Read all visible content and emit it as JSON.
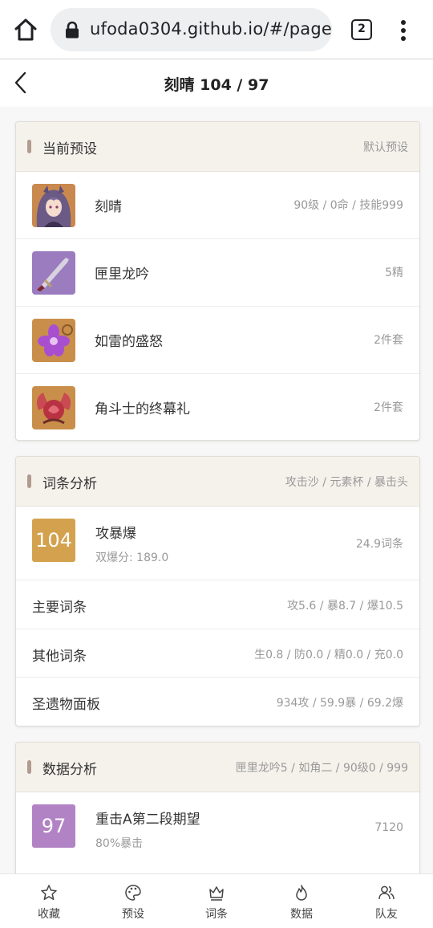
{
  "browser": {
    "url": "ufoda0304.github.io/#/pages",
    "tab_count": "2"
  },
  "header": {
    "title": "刻晴 104 / 97"
  },
  "preset": {
    "title": "当前预设",
    "right": "默认预设",
    "items": [
      {
        "icon": "keqing-character-portrait",
        "name": "刻晴",
        "value": "90级 / 0命 / 技能999"
      },
      {
        "icon": "mistsplitter-sword-icon",
        "name": "匣里龙吟",
        "value": "5精"
      },
      {
        "icon": "thundering-fury-flower-icon",
        "name": "如雷的盛怒",
        "value": "2件套"
      },
      {
        "icon": "gladiator-flower-icon",
        "name": "角斗士的终幕礼",
        "value": "2件套"
      }
    ]
  },
  "substats": {
    "title": "词条分析",
    "right": "攻击沙 / 元素杯 / 暴击头",
    "score": "104",
    "score_color": "#d4a24e",
    "score_title": "攻暴爆",
    "score_sub": "双爆分: 189.0",
    "score_value": "24.9词条",
    "rows": [
      {
        "label": "主要词条",
        "value": "攻5.6 / 暴8.7 / 爆10.5"
      },
      {
        "label": "其他词条",
        "value": "生0.8 / 防0.0 / 精0.0 / 充0.0"
      },
      {
        "label": "圣遗物面板",
        "value": "934攻 / 59.9暴 / 69.2爆"
      }
    ]
  },
  "damage": {
    "title": "数据分析",
    "right": "匣里龙吟5 / 如角二 / 90级0 / 999",
    "score": "97",
    "score_color": "#b283c4",
    "score_title": "重击A第二段期望",
    "score_sub": "80%暴击",
    "score_value": "7120"
  },
  "tabbar": [
    {
      "icon": "star-icon",
      "label": "收藏"
    },
    {
      "icon": "palette-icon",
      "label": "预设"
    },
    {
      "icon": "crown-icon",
      "label": "词条"
    },
    {
      "icon": "flame-icon",
      "label": "数据"
    },
    {
      "icon": "users-icon",
      "label": "队友"
    }
  ]
}
